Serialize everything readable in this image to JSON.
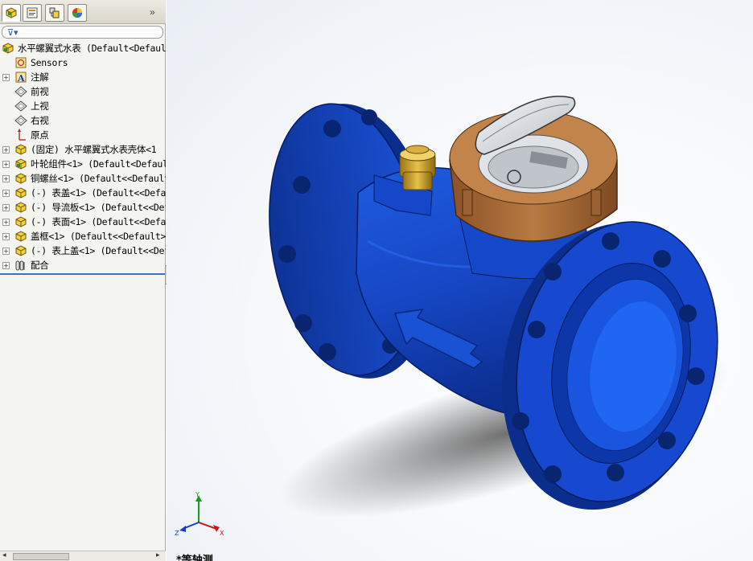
{
  "feature_tree": {
    "items": [
      {
        "label": "水平螺翼式水表  (Default<Default",
        "expander": "",
        "icon": "assembly-icon",
        "indent": 0
      },
      {
        "label": "Sensors",
        "expander": "",
        "icon": "sensors-icon",
        "indent": 1
      },
      {
        "label": "注解",
        "expander": "+",
        "icon": "annotations-icon",
        "indent": 1
      },
      {
        "label": "前视",
        "expander": "",
        "icon": "plane-icon",
        "indent": 1
      },
      {
        "label": "上视",
        "expander": "",
        "icon": "plane-icon",
        "indent": 1
      },
      {
        "label": "右视",
        "expander": "",
        "icon": "plane-icon",
        "indent": 1
      },
      {
        "label": "原点",
        "expander": "",
        "icon": "origin-icon",
        "indent": 1
      },
      {
        "label": "(固定) 水平螺翼式水表壳体<1",
        "expander": "+",
        "icon": "component-icon",
        "indent": 1
      },
      {
        "label": "叶轮组件<1> (Default<Defaul",
        "expander": "+",
        "icon": "subassembly-icon",
        "indent": 1
      },
      {
        "label": "铜螺丝<1> (Default<<Default",
        "expander": "+",
        "icon": "component-icon",
        "indent": 1
      },
      {
        "label": "(-) 表盖<1> (Default<<Defau",
        "expander": "+",
        "icon": "component-icon",
        "indent": 1
      },
      {
        "label": "(-) 导流板<1> (Default<<Def",
        "expander": "+",
        "icon": "component-icon",
        "indent": 1
      },
      {
        "label": "(-) 表面<1> (Default<<Defau",
        "expander": "+",
        "icon": "component-icon",
        "indent": 1
      },
      {
        "label": "盖框<1> (Default<<Default>_",
        "expander": "+",
        "icon": "component-icon",
        "indent": 1
      },
      {
        "label": "(-) 表上盖<1> (Default<<Def",
        "expander": "+",
        "icon": "component-icon",
        "indent": 1
      },
      {
        "label": "配合",
        "expander": "+",
        "icon": "mates-icon",
        "indent": 1
      }
    ]
  },
  "panel": {
    "tabs": [
      "feature-manager-icon",
      "property-manager-icon",
      "configuration-manager-icon",
      "display-manager-icon"
    ],
    "expand_glyph": "»"
  },
  "viewport": {
    "view_name": "*等轴测",
    "triad": {
      "x": "X",
      "y": "Y",
      "z": "Z"
    },
    "colors": {
      "body_blue": "#1546c6",
      "body_dark": "#0a2a80",
      "register_brown": "#a86a35",
      "brass": "#c9a030"
    }
  }
}
